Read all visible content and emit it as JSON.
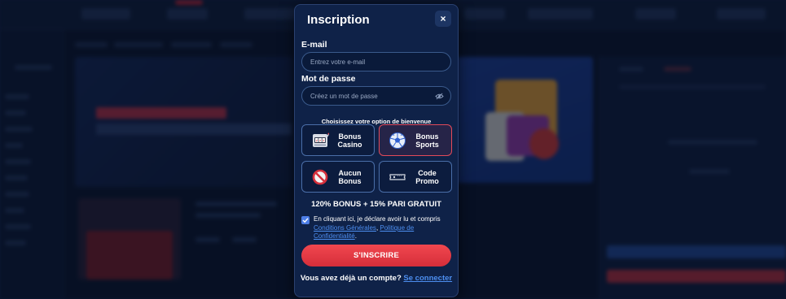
{
  "modal": {
    "title": "Inscription",
    "close_label": "×"
  },
  "email": {
    "label": "E-mail",
    "placeholder": "Entrez votre e-mail",
    "value": ""
  },
  "password": {
    "label": "Mot de passe",
    "placeholder": "Créez un mot de passe",
    "value": ""
  },
  "welcome": {
    "label": "Choisissez votre option de bienvenue",
    "options": [
      {
        "label": "Bonus\nCasino",
        "icon": "slot-machine-icon",
        "selected": false
      },
      {
        "label": "Bonus\nSports",
        "icon": "soccer-ball-icon",
        "selected": true
      },
      {
        "label": "Aucun\nBonus",
        "icon": "no-bonus-icon",
        "selected": false
      },
      {
        "label": "Code\nPromo",
        "icon": "promo-ticket-icon",
        "selected": false
      }
    ]
  },
  "bonus_text": "120% BONUS + 15% PARI GRATUIT",
  "consent": {
    "checked": true,
    "text_before": "En cliquant ici, je déclare avoir lu et compris",
    "link_terms": "Conditions Générales",
    "separator": ", ",
    "link_privacy": "Politique de Confidentialité",
    "text_after": "."
  },
  "submit_label": "S'INSCRIRE",
  "login": {
    "prompt": "Vous avez déjà un compte?",
    "link": "Se connecter"
  },
  "colors": {
    "accent_red": "#e2434c",
    "link_blue": "#4d8ef0",
    "modal_bg": "#0f2248"
  }
}
